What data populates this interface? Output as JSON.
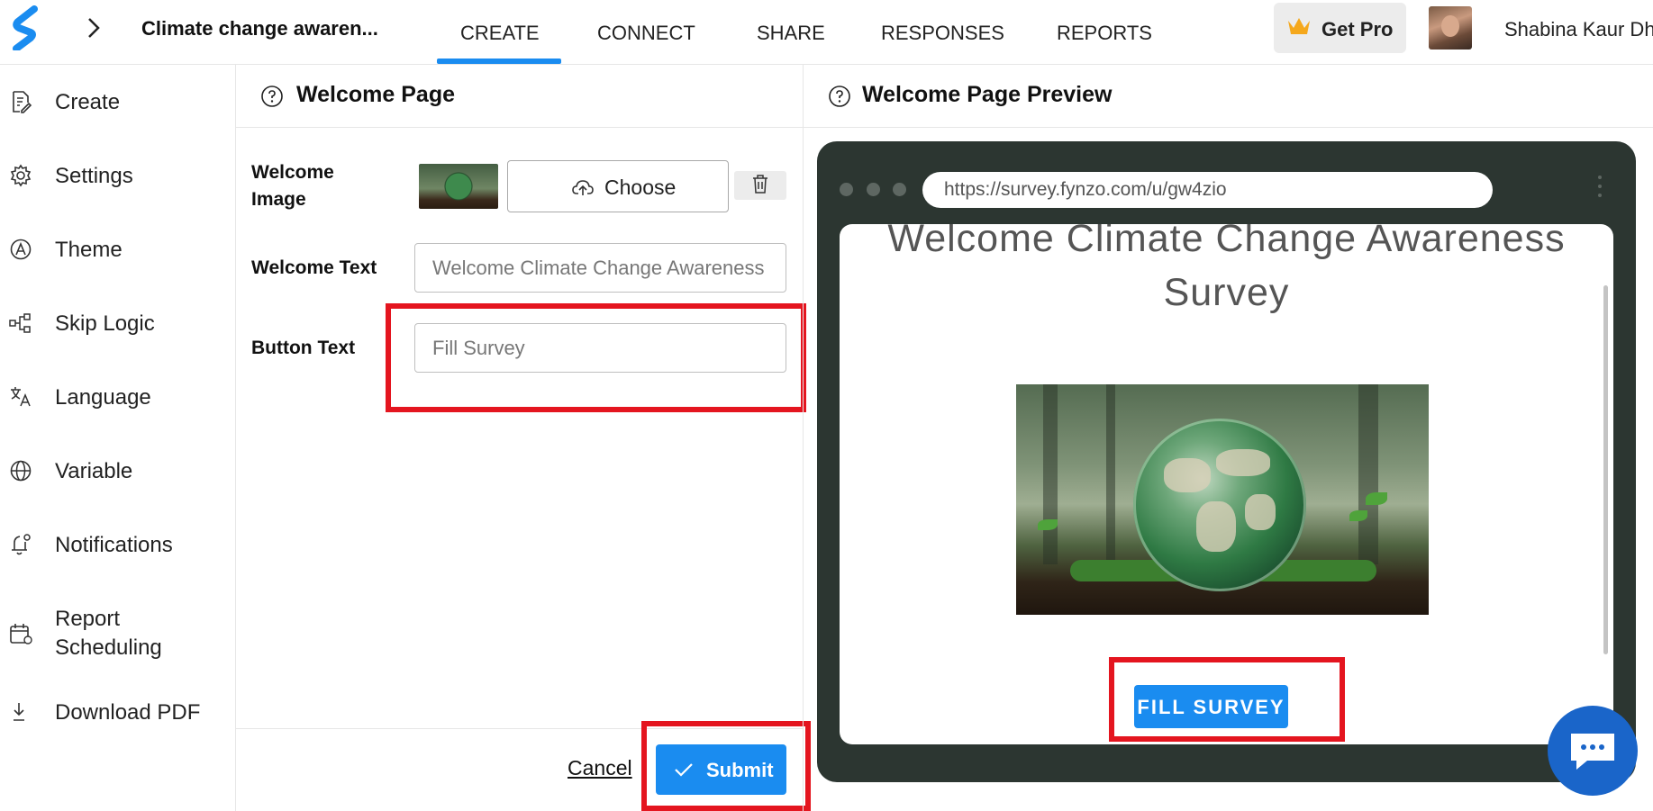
{
  "header": {
    "survey_title": "Climate change awaren...",
    "tabs": [
      {
        "label": "CREATE",
        "active": true
      },
      {
        "label": "CONNECT"
      },
      {
        "label": "SHARE"
      },
      {
        "label": "RESPONSES"
      },
      {
        "label": "REPORTS"
      }
    ],
    "get_pro_label": "Get Pro",
    "user_name": "Shabina Kaur Dh",
    "accent_color": "#1a8cf0"
  },
  "sidebar": {
    "items": [
      {
        "label": "Create",
        "icon": "document-edit-icon"
      },
      {
        "label": "Settings",
        "icon": "gear-icon"
      },
      {
        "label": "Theme",
        "icon": "palette-icon"
      },
      {
        "label": "Skip Logic",
        "icon": "flow-icon"
      },
      {
        "label": "Language",
        "icon": "translate-icon"
      },
      {
        "label": "Variable",
        "icon": "globe-icon"
      },
      {
        "label": "Notifications",
        "icon": "bell-icon"
      },
      {
        "label": "Report Scheduling",
        "icon": "calendar-icon"
      },
      {
        "label": "Download PDF",
        "icon": "download-icon"
      }
    ]
  },
  "editor": {
    "title": "Welcome Page",
    "welcome_image_label": "Welcome Image",
    "choose_label": "Choose",
    "welcome_text_label": "Welcome Text",
    "welcome_text_value": "Welcome Climate Change Awareness Survey",
    "button_text_label": "Button Text",
    "button_text_value": "Fill Survey",
    "cancel_label": "Cancel",
    "submit_label": "Submit"
  },
  "preview": {
    "title": "Welcome Page Preview",
    "url": "https://survey.fynzo.com/u/gw4zio",
    "welcome_heading": "Welcome Climate Change Awareness Survey",
    "fill_button_label": "FILL SURVEY",
    "frame_color": "#2c3631"
  },
  "highlight_color": "#e4151f"
}
